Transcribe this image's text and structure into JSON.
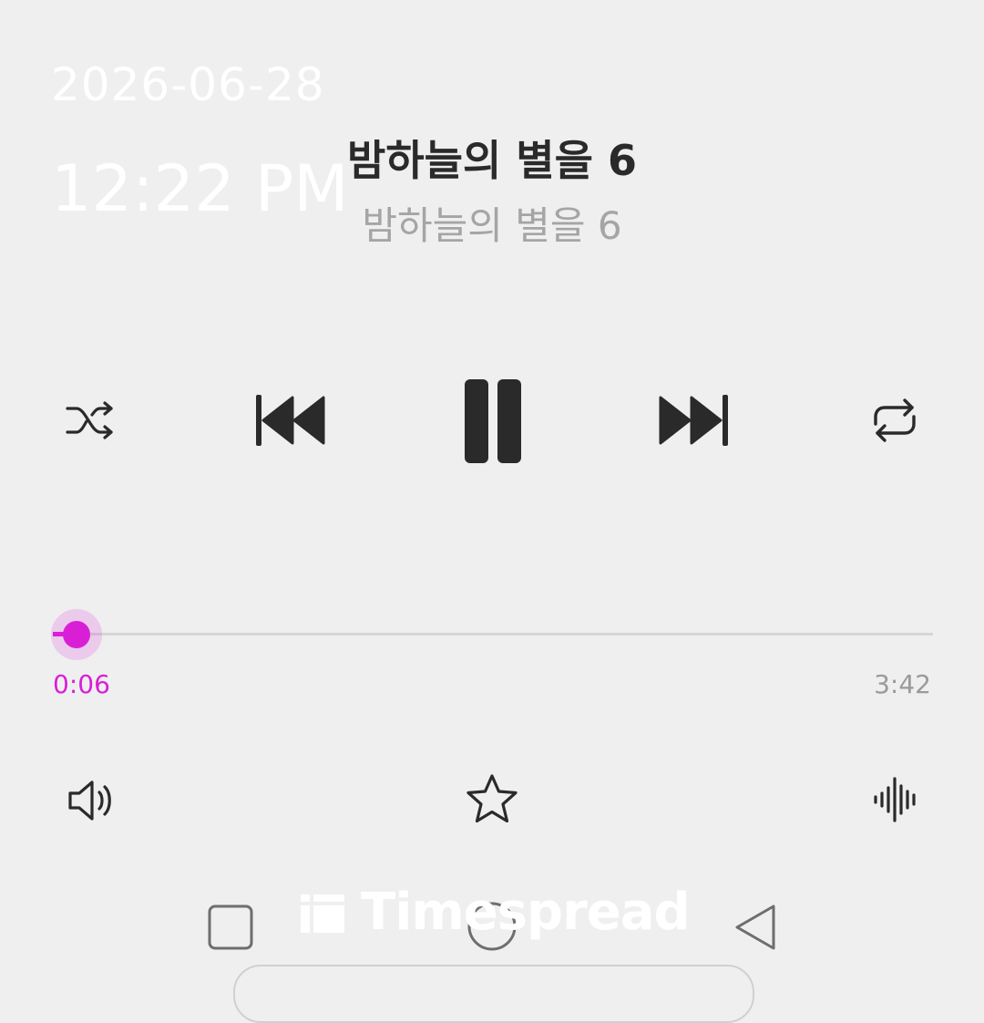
{
  "status": {
    "date": "2026-06-28",
    "time": "12:22 PM"
  },
  "track": {
    "title": "밤하늘의 별을 6",
    "artist": "밤하늘의 별을 6"
  },
  "playback": {
    "state": "playing",
    "current_time": "0:06",
    "total_time": "3:42",
    "progress_fraction": 0.027,
    "shuffle": "shuffle-icon",
    "previous": "skip-previous-icon",
    "pause": "pause-icon",
    "next": "skip-next-icon",
    "repeat": "repeat-icon"
  },
  "bottom_actions": {
    "volume": "volume-icon",
    "favorite": "star-icon",
    "equalizer": "audio-wave-icon"
  },
  "navigation": {
    "recent": "square-icon",
    "home": "circle-icon",
    "back": "triangle-back-icon"
  },
  "watermark": {
    "text": "Timespread"
  },
  "colors": {
    "accent": "#d91fd6",
    "background": "#efefef",
    "icon": "#2a2a2a",
    "subtitle": "#a5a5a5"
  }
}
